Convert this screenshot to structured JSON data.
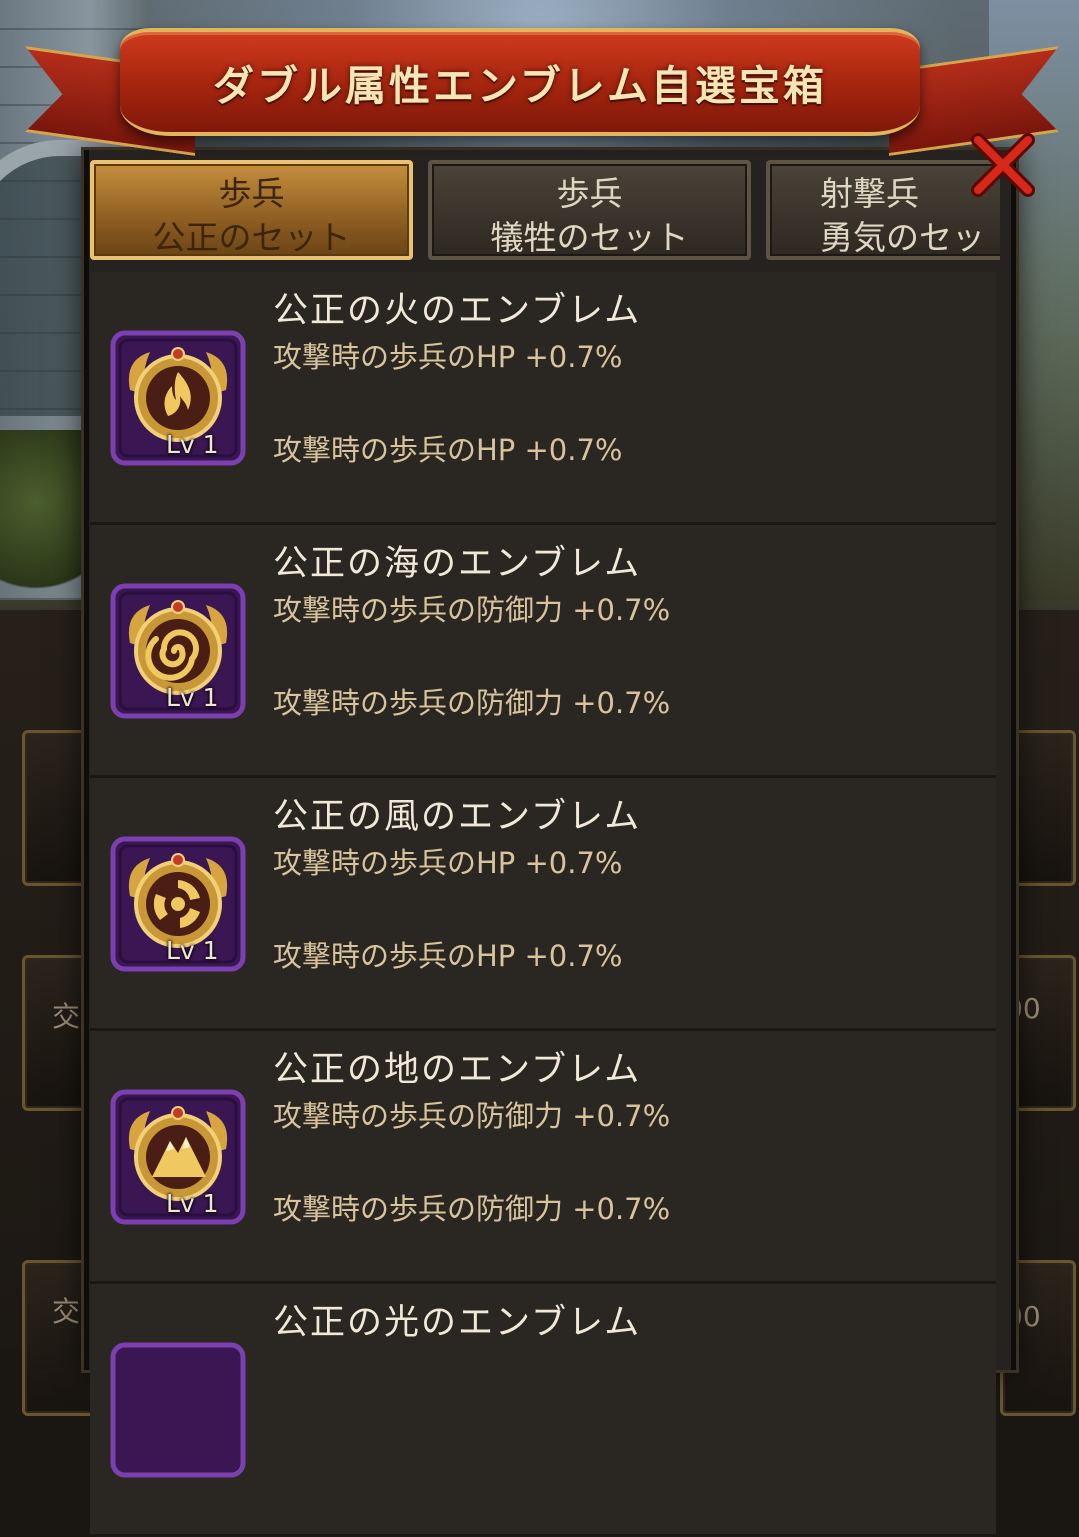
{
  "title": "ダブル属性エンブレム自選宝箱",
  "tabs": [
    {
      "line1": "歩兵",
      "line2": "公正のセット",
      "active": true
    },
    {
      "line1": "歩兵",
      "line2": "犠牲のセット",
      "active": false
    },
    {
      "line1": "射撃兵",
      "line2": "勇気のセッ",
      "active": false
    }
  ],
  "emblems": [
    {
      "name": "公正の火のエンブレム",
      "icon": "flame-icon",
      "level": "Lv 1",
      "stat1": "攻撃時の歩兵のHP +0.7%",
      "stat2": "攻撃時の歩兵のHP +0.7%"
    },
    {
      "name": "公正の海のエンブレム",
      "icon": "wave-spiral-icon",
      "level": "Lv 1",
      "stat1": "攻撃時の歩兵の防御力 +0.7%",
      "stat2": "攻撃時の歩兵の防御力 +0.7%"
    },
    {
      "name": "公正の風のエンブレム",
      "icon": "wind-swirl-icon",
      "level": "Lv 1",
      "stat1": "攻撃時の歩兵のHP +0.7%",
      "stat2": "攻撃時の歩兵のHP +0.7%"
    },
    {
      "name": "公正の地のエンブレム",
      "icon": "mountain-icon",
      "level": "Lv 1",
      "stat1": "攻撃時の歩兵の防御力 +0.7%",
      "stat2": "攻撃時の歩兵の防御力 +0.7%"
    },
    {
      "name": "公正の光のエンブレム",
      "icon": "light-icon",
      "level": "",
      "stat1": "",
      "stat2": ""
    }
  ],
  "background": {
    "side_text_a": "交",
    "side_text_b": "00",
    "side_text_c": "交",
    "side_text_d": "00"
  },
  "colors": {
    "ribbon": "#b42d1a",
    "gold": "#e2b55a",
    "panel": "#262220",
    "stat_text": "#d8c39c",
    "icon_frame": "#5b2a8a"
  }
}
